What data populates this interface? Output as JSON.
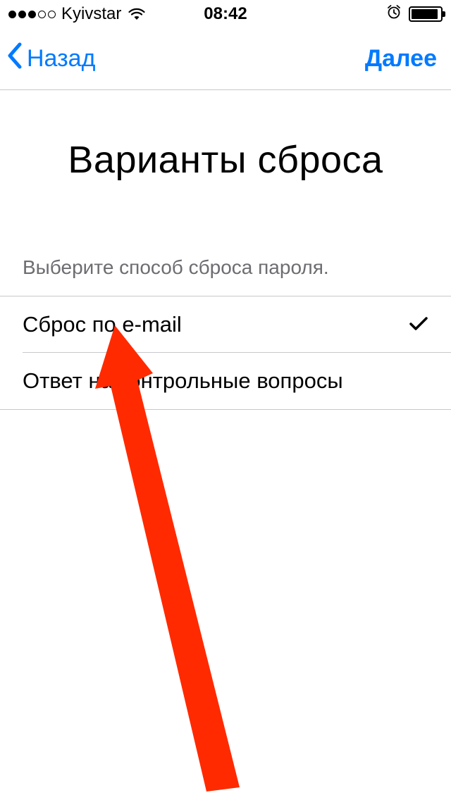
{
  "status_bar": {
    "carrier": "Kyivstar",
    "time": "08:42",
    "battery_percent": 85
  },
  "nav": {
    "back_label": "Назад",
    "next_label": "Далее"
  },
  "page": {
    "title": "Варианты сброса",
    "section_header": "Выберите способ сброса пароля."
  },
  "options": [
    {
      "label": "Сброс по e-mail",
      "selected": true
    },
    {
      "label": "Ответ на контрольные вопросы",
      "selected": false
    }
  ],
  "colors": {
    "accent": "#007aff",
    "annotation": "#ff2a00"
  }
}
